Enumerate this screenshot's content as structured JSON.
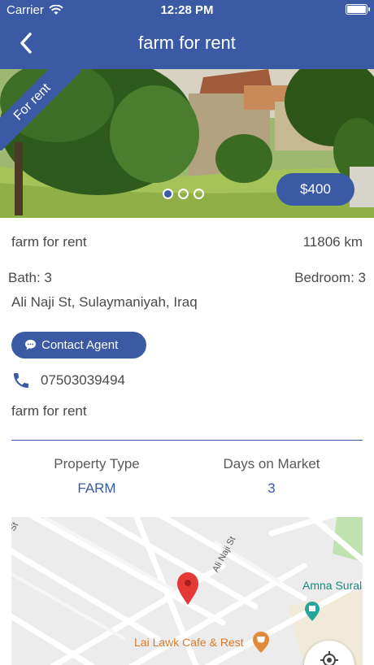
{
  "status_bar": {
    "carrier": "Carrier",
    "time": "12:28 PM"
  },
  "nav": {
    "title": "farm for rent",
    "back_icon": "chevron-left-icon"
  },
  "hero": {
    "ribbon": "For rent",
    "price": "$400",
    "pages": 3,
    "active_page": 1
  },
  "details": {
    "name": "farm for rent",
    "distance": "11806 km",
    "bath": "Bath: 3",
    "bedroom": "Bedroom: 3",
    "address": "Ali Naji St, Sulaymaniyah, Iraq",
    "contact_label": "Contact Agent",
    "phone": "07503039494",
    "description": "farm for rent"
  },
  "stats": [
    {
      "label": "Property Type",
      "value": "FARM"
    },
    {
      "label": "Days on Market",
      "value": "3"
    }
  ],
  "map": {
    "street": "Ali Naji St",
    "poi_1": "Amna Sural",
    "poi_2": "Lai Lawk Cafe & Rest",
    "stub": "St"
  },
  "colors": {
    "primary": "#3a5aa6",
    "pin": "#e53935",
    "poi_cafe": "#e08b3a",
    "poi_teal": "#26a69a"
  }
}
